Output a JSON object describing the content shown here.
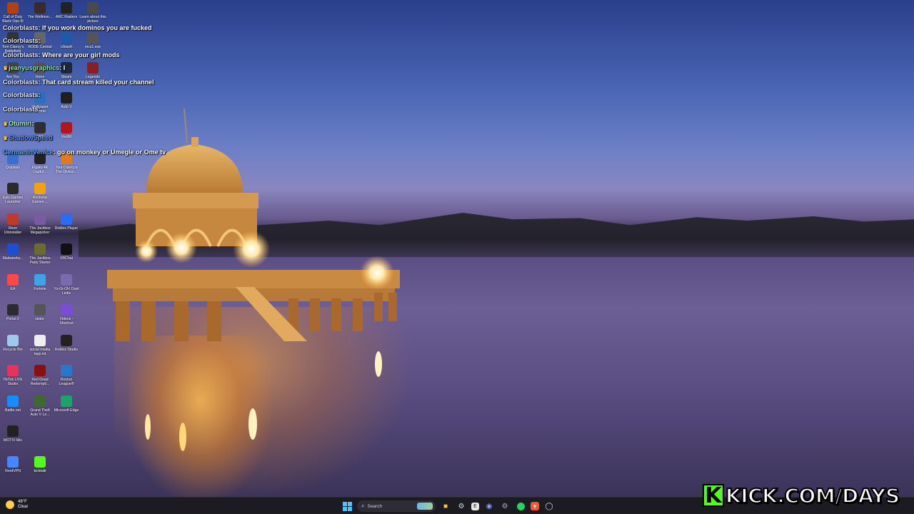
{
  "desktop_icons": [
    {
      "label": "Call of Duty Black Ops III",
      "icon": "call-of-duty-icon",
      "color": "#b3400d"
    },
    {
      "label": "The Wellmon...",
      "icon": "wellmon-icon",
      "color": "#3b2a2a"
    },
    {
      "label": "ARC Raiders",
      "icon": "arc-raiders-icon",
      "color": "#222222"
    },
    {
      "label": "Learn about this picture",
      "icon": "camera-icon",
      "color": "#4a4a4a"
    },
    {
      "label": "Tom Clancy's Battlefield",
      "icon": "battlefield-icon",
      "color": "#333333"
    },
    {
      "label": "RODE Central",
      "icon": "rode-icon",
      "color": "#666666"
    },
    {
      "label": "Ubisoft",
      "icon": "ubisoft-icon",
      "color": "#1e5aa8"
    },
    {
      "label": "mcs1.exe",
      "icon": "exe-icon",
      "color": "#555555"
    },
    {
      "label": "Are You",
      "icon": "are-you-icon",
      "color": "#444444"
    },
    {
      "label": "Hone",
      "icon": "hone-icon",
      "color": "#555555"
    },
    {
      "label": "Steam",
      "icon": "steam-icon",
      "color": "#1b2838"
    },
    {
      "label": "Legends",
      "icon": "legends-icon",
      "color": "#8a1f1f"
    },
    {
      "label": "Wallpaper Engine",
      "icon": "wallpaper-engine-icon",
      "color": "#2c6fc1"
    },
    {
      "label": "Auto V",
      "icon": "gta-icon",
      "color": "#1f1f1f"
    },
    {
      "label": "OBS",
      "icon": "obs-icon",
      "color": "#302e31"
    },
    {
      "label": "RedM",
      "icon": "redm-icon",
      "color": "#b4141b"
    },
    {
      "label": "Quiplash",
      "icon": "quiplash-icon",
      "color": "#3b6fcf"
    },
    {
      "label": "Elgato 4K Captur...",
      "icon": "elgato-icon",
      "color": "#222222"
    },
    {
      "label": "Tom Clancy's The Divisio...",
      "icon": "division-icon",
      "color": "#e07b18"
    },
    {
      "label": "Epic Games Launcher",
      "icon": "epic-games-icon",
      "color": "#2a2a2a"
    },
    {
      "label": "Rockstar Games ...",
      "icon": "rockstar-icon",
      "color": "#f2a20d"
    },
    {
      "label": "Revo Uninstaller",
      "icon": "revo-icon",
      "color": "#c0392b"
    },
    {
      "label": "The Jackbox Megapicker",
      "icon": "jackbox-icon",
      "color": "#7a5aa0"
    },
    {
      "label": "Roblox Player",
      "icon": "roblox-icon",
      "color": "#2b6cf0"
    },
    {
      "label": "Malwareby...",
      "icon": "malwarebytes-icon",
      "color": "#1d4ed8"
    },
    {
      "label": "The Jackbox Party Starter",
      "icon": "jackbox-party-icon",
      "color": "#6b6b2a"
    },
    {
      "label": "VRChat",
      "icon": "vrchat-icon",
      "color": "#111111"
    },
    {
      "label": "EA",
      "icon": "ea-icon",
      "color": "#ff4747"
    },
    {
      "label": "Fortnite",
      "icon": "fortnite-icon",
      "color": "#3aa5e8"
    },
    {
      "label": "Yu-Gi-Oh! Duel Links",
      "icon": "yugioh-icon",
      "color": "#7a6ab0"
    },
    {
      "label": "Portal 2",
      "icon": "portal-icon",
      "color": "#2c2c2c"
    },
    {
      "label": "skate.",
      "icon": "skate-icon",
      "color": "#555555"
    },
    {
      "label": "Videos - Shortcut",
      "icon": "videos-icon",
      "color": "#7b4cd8"
    },
    {
      "label": "Recycle Bin",
      "icon": "recycle-bin-icon",
      "color": "#9ec9e8"
    },
    {
      "label": "social media tags.txt",
      "icon": "text-file-icon",
      "color": "#eeeeee"
    },
    {
      "label": "Roblox Studio",
      "icon": "roblox-studio-icon",
      "color": "#222222"
    },
    {
      "label": "TikTok LIVE Studio",
      "icon": "tiktok-icon",
      "color": "#e6335e"
    },
    {
      "label": "Red Dead Redempti...",
      "icon": "red-dead-icon",
      "color": "#8a1010"
    },
    {
      "label": "Rocket League®",
      "icon": "rocket-league-icon",
      "color": "#2a77c9"
    },
    {
      "label": "Battle.net",
      "icon": "battlenet-icon",
      "color": "#148eff"
    },
    {
      "label": "Grand Theft Auto V Le...",
      "icon": "gta-v-icon",
      "color": "#3e6a2e"
    },
    {
      "label": "Microsoft Edge",
      "icon": "edge-icon",
      "color": "#1aa36b"
    },
    {
      "label": "MOTIV Mix",
      "icon": "motiv-icon",
      "color": "#222222"
    },
    {
      "label": "NordVPN",
      "icon": "nordvpn-icon",
      "color": "#4687ff"
    },
    {
      "label": "kicktalk",
      "icon": "kicktalk-icon",
      "color": "#53fc18"
    }
  ],
  "chat": [
    {
      "user": "Colorblasts",
      "sep": ": ",
      "text": "If you work dominos you are fucked"
    },
    {
      "user": "Colorblasts",
      "sep": ": ",
      "text": ""
    },
    {
      "user": "Colorblasts",
      "sep": ": ",
      "text": "Where are your girl mods"
    },
    {
      "user": "jeanyusgraphics",
      "sep": ": ",
      "text": "I"
    },
    {
      "user": "Colorblasts",
      "sep": ": ",
      "text": "That card stream killed your channel"
    },
    {
      "user": "Colorblasts",
      "sep": ": ",
      "text": ""
    },
    {
      "user": "Colorblasts",
      "sep": ": ",
      "text": ""
    },
    {
      "user": "Otumiri",
      "sep": ": ",
      "text": ""
    },
    {
      "user": "ShadowSpeed",
      "sep": "",
      "text": ""
    },
    {
      "user": "GermaninVenice",
      "sep": ": ",
      "text": "go on monkey or Umegle or Ome tv"
    }
  ],
  "taskbar": {
    "weather_temp": "48°F",
    "weather_desc": "Clear",
    "search_placeholder": "Search"
  },
  "overlay": {
    "kick_text": "KICK.COM/DAYS",
    "kick_letter": "K"
  },
  "colors": {
    "kick_green": "#53fc18",
    "taskbar_bg": "#1c1b22"
  }
}
